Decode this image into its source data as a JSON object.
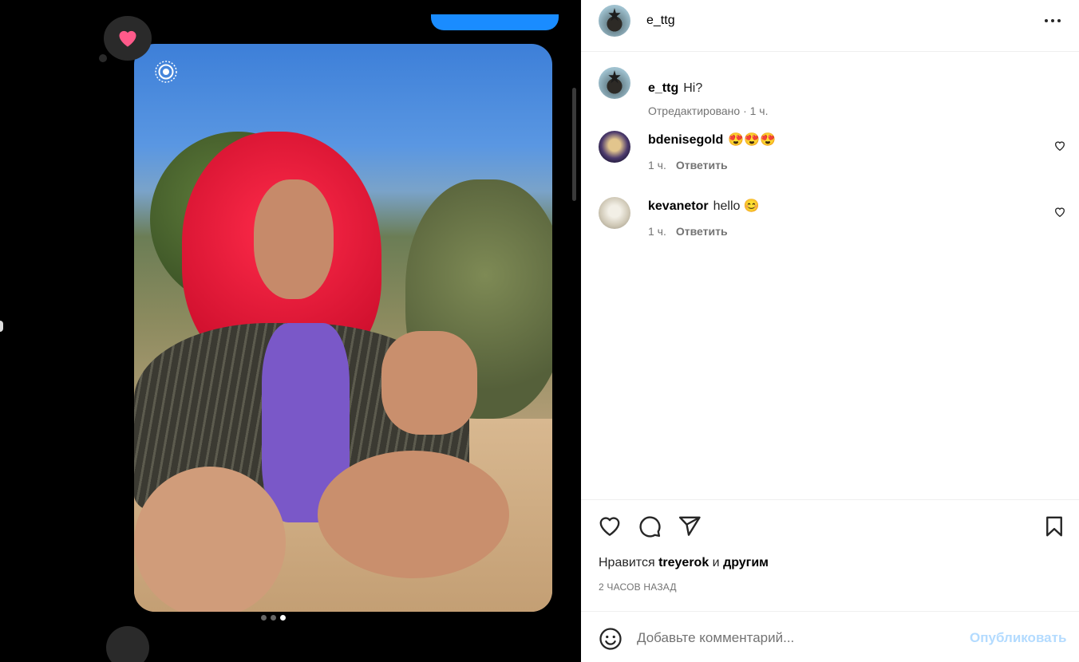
{
  "post": {
    "author": "e_ttg",
    "more_icon": "more-horizontal-icon"
  },
  "caption": {
    "username": "e_ttg",
    "text": "Hi?",
    "meta": "Отредактировано · 1 ч."
  },
  "comments": [
    {
      "username": "bdenisegold",
      "text": "😍😍😍",
      "time": "1 ч.",
      "reply_label": "Ответить"
    },
    {
      "username": "kevanetor",
      "text": "hello 😊",
      "time": "1 ч.",
      "reply_label": "Ответить"
    }
  ],
  "actions": {
    "likes_prefix": "Нравится",
    "likes_user": "treyerok",
    "likes_conj": "и",
    "likes_suffix": "другим",
    "time_ago": "2 ЧАСОВ НАЗАД"
  },
  "composer": {
    "placeholder": "Добавьте комментарий...",
    "publish_label": "Опубликовать"
  },
  "carousel": {
    "count": 3,
    "active_index": 2
  },
  "colors": {
    "accent": "#0095f6",
    "publish_disabled": "#b3dbff",
    "reaction_heart": "#ff5a8a"
  }
}
